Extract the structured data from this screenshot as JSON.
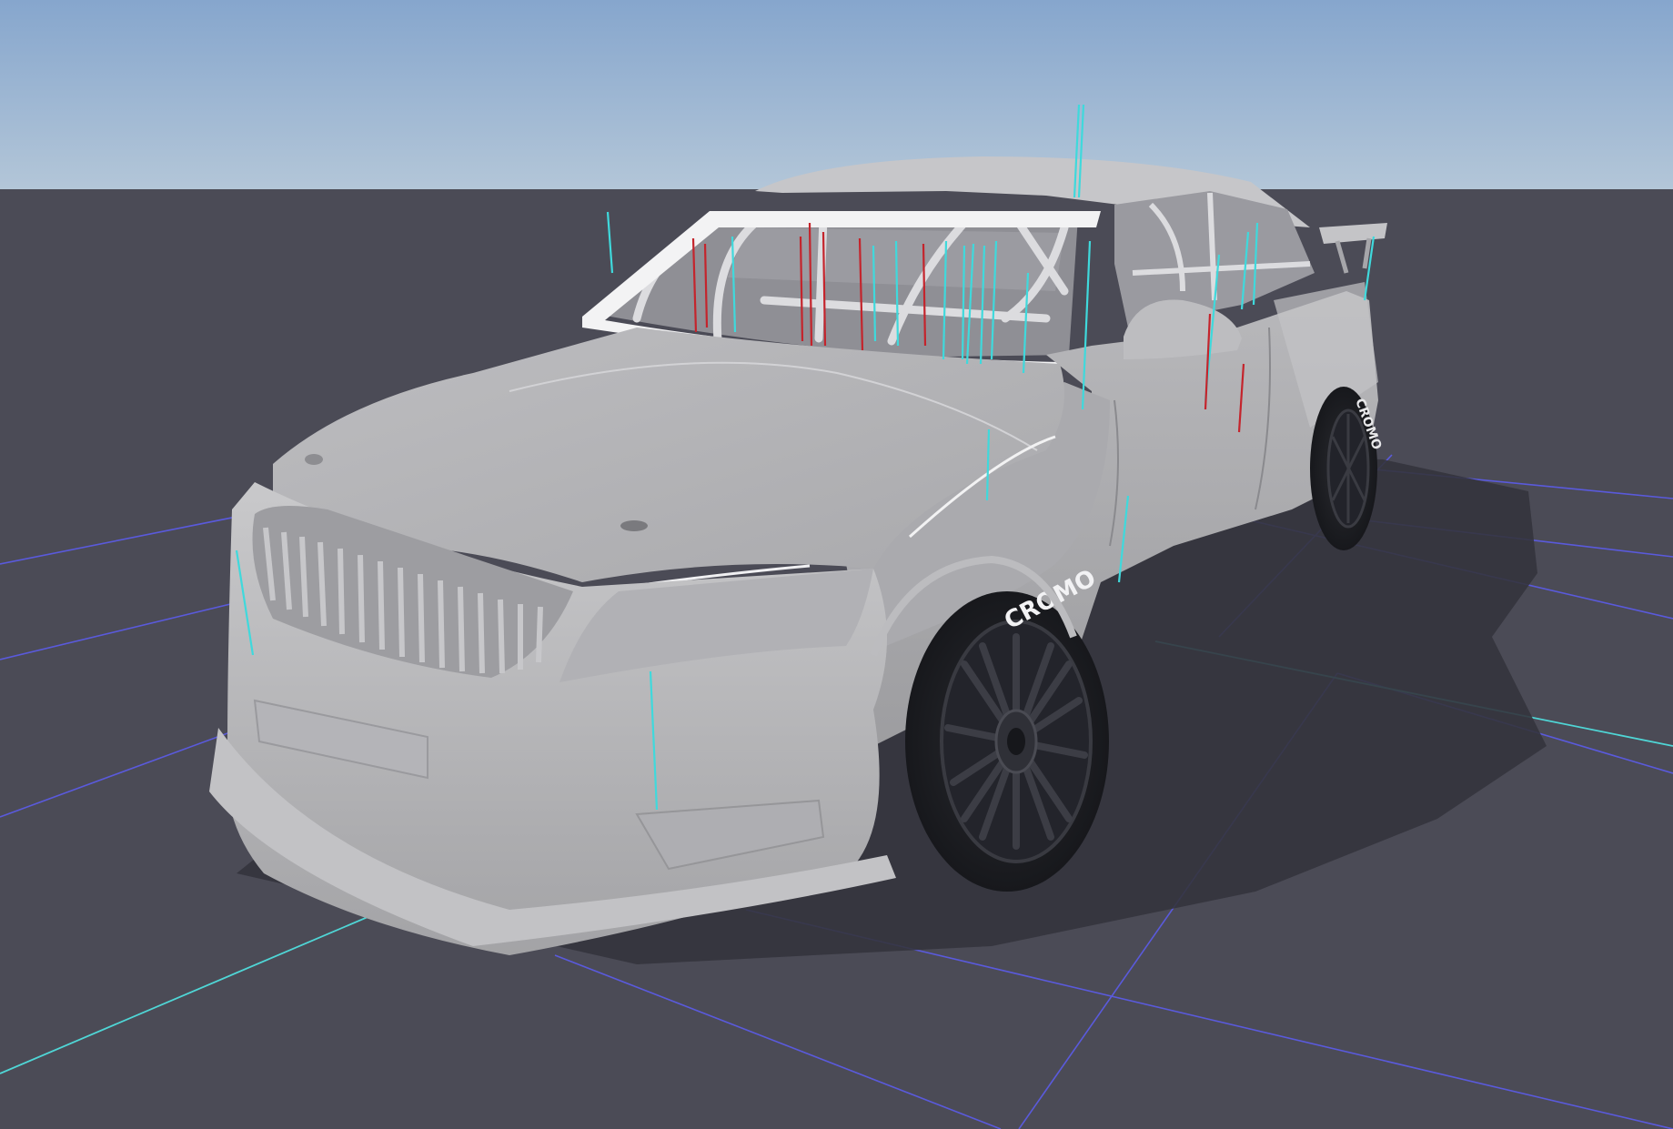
{
  "viewport": {
    "sky_top_color": "#86a6cd",
    "sky_horizon_color": "#b3c6d8",
    "ground_color": "#4b4b56",
    "grid_color": "#5a5adc",
    "x_axis_color": "#4fd6d6",
    "car_body_color": "#b9b9bc",
    "tire_color": "#1d1e22",
    "probe_colors": [
      "#3fd9dc",
      "#c4242c"
    ]
  },
  "car": {
    "front_tire_text": "CROMO",
    "rear_tire_text": "CROMO"
  }
}
